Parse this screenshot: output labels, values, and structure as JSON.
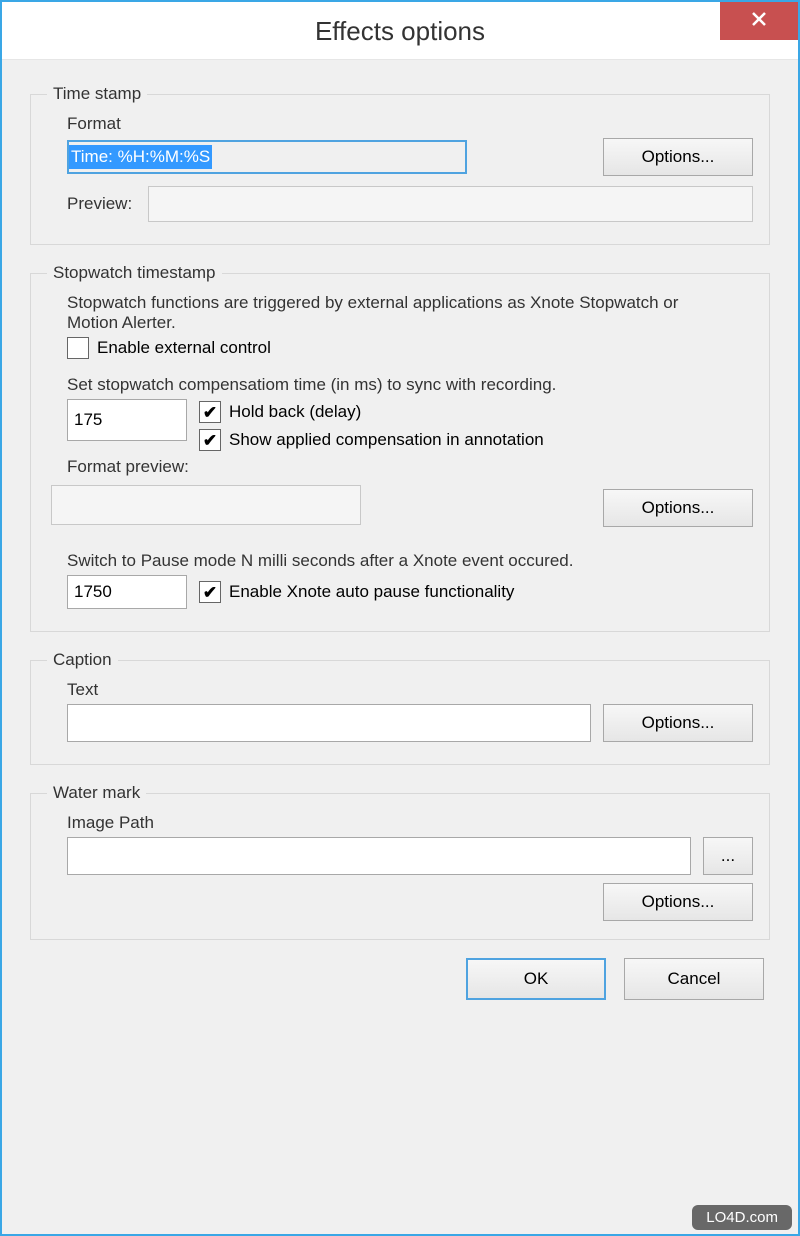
{
  "window": {
    "title": "Effects options"
  },
  "buttons": {
    "options": "Options...",
    "ok": "OK",
    "cancel": "Cancel",
    "browse": "..."
  },
  "timestamp": {
    "legend": "Time stamp",
    "format_label": "Format",
    "format_value": "Time: %H:%M:%S",
    "preview_label": "Preview:"
  },
  "stopwatch": {
    "legend": "Stopwatch timestamp",
    "info": "Stopwatch functions are triggered by external applications as Xnote Stopwatch or Motion Alerter.",
    "enable_external_label": "Enable external control",
    "enable_external_checked": false,
    "compensation_label": "Set stopwatch compensatiom time (in ms) to sync with recording.",
    "compensation_value": "175",
    "hold_back_label": "Hold back (delay)",
    "hold_back_checked": true,
    "show_comp_label": "Show applied compensation in annotation",
    "show_comp_checked": true,
    "format_preview_label": "Format preview:",
    "pause_label": "Switch to Pause mode N milli seconds after a Xnote event occured.",
    "pause_value": "1750",
    "enable_pause_label": "Enable Xnote auto pause functionality",
    "enable_pause_checked": true
  },
  "caption": {
    "legend": "Caption",
    "text_label": "Text",
    "text_value": ""
  },
  "watermark": {
    "legend": "Water mark",
    "path_label": "Image Path",
    "path_value": ""
  },
  "badge": "LO4D.com"
}
